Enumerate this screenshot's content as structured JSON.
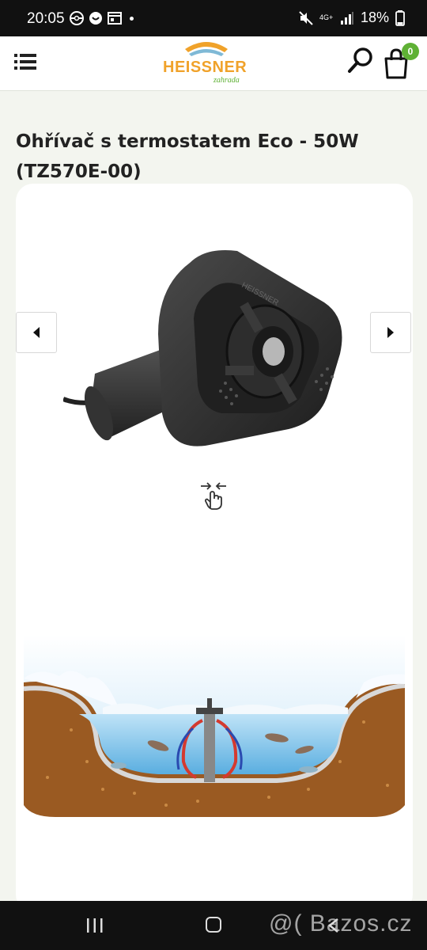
{
  "status_bar": {
    "time": "20:05",
    "network": "4G+",
    "battery": "18%"
  },
  "header": {
    "logo_text": "HEISSNER",
    "logo_sub": "zahrada",
    "cart_count": "0",
    "icons": {
      "menu": "hamburger-icon",
      "search": "search-icon",
      "cart": "shopping-bag-icon"
    },
    "accent_color": "#5fb135",
    "logo_color": "#f0a22a"
  },
  "product": {
    "title": "Ohřívač s termostatem Eco - 50W (TZ570E-00)"
  },
  "gallery": {
    "prev_icon": "chevron-left-icon",
    "next_icon": "chevron-right-icon",
    "swipe_icon": "swipe-hand-icon",
    "product_brand_mark": "HEISSNER"
  },
  "nav_bar": {
    "watermark": "@( Bazos.cz"
  }
}
